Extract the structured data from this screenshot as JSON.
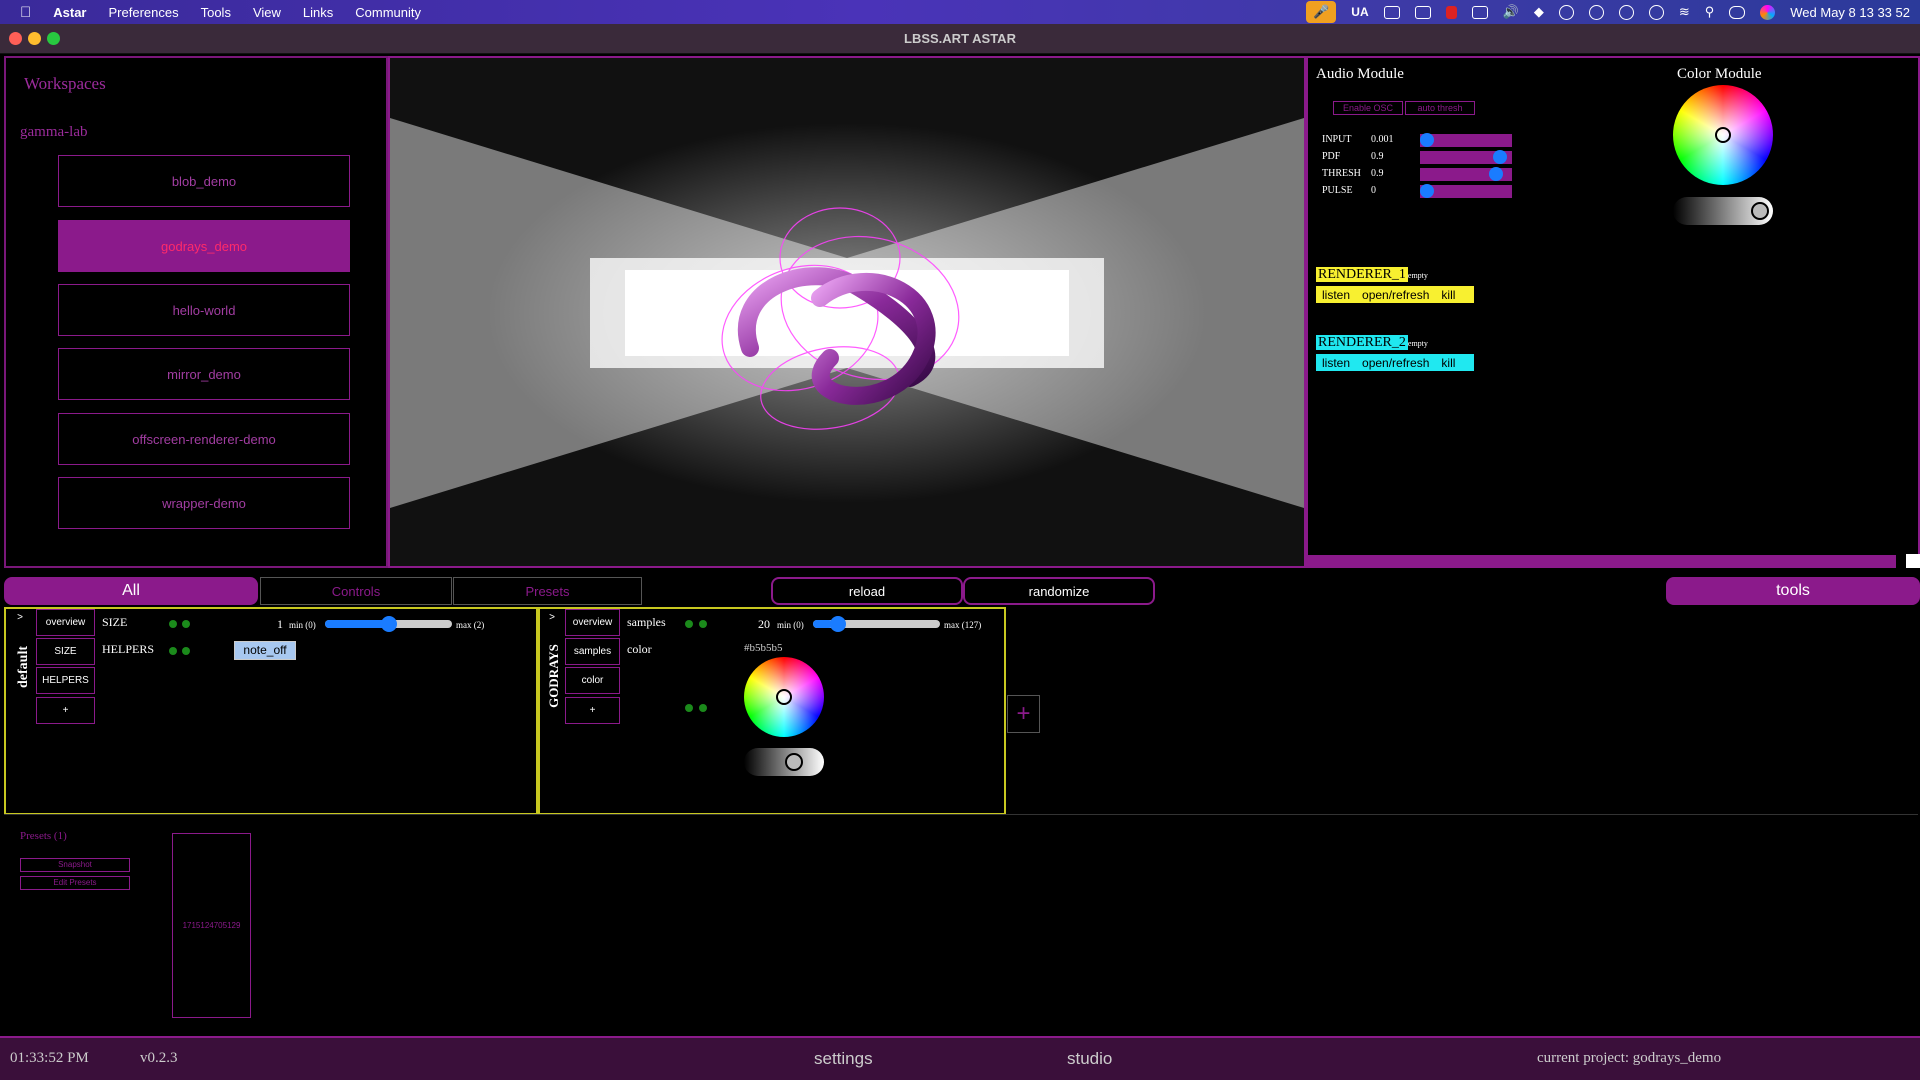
{
  "menubar": {
    "app": "Astar",
    "items": [
      "Preferences",
      "Tools",
      "View",
      "Links",
      "Community"
    ],
    "lang": "UA",
    "clock": "Wed May 8  13 33 52"
  },
  "window": {
    "title": "LBSS.ART ASTAR"
  },
  "workspaces": {
    "title": "Workspaces",
    "group": "gamma-lab",
    "items": [
      {
        "label": "blob_demo"
      },
      {
        "label": "godrays_demo"
      },
      {
        "label": "hello-world"
      },
      {
        "label": "mirror_demo"
      },
      {
        "label": "offscreen-renderer-demo"
      },
      {
        "label": "wrapper-demo"
      }
    ]
  },
  "audio": {
    "title": "Audio Module",
    "enable_osc": "Enable OSC",
    "auto_thresh": "auto thresh",
    "rows": [
      {
        "label": "INPUT",
        "value": "0.001",
        "level": 0.001
      },
      {
        "label": "PDF",
        "value": "0.9",
        "level": 0.9
      },
      {
        "label": "THRESH",
        "value": "0.9",
        "level": 0.9
      },
      {
        "label": "PULSE",
        "value": "0",
        "level": 0
      }
    ]
  },
  "color_module": {
    "title": "Color Module"
  },
  "renderers": [
    {
      "name": "RENDERER_1",
      "status": "empty",
      "listen": "listen",
      "open": "open/refresh",
      "kill": "kill",
      "color": "#f8f030"
    },
    {
      "name": "RENDERER_2",
      "status": "empty",
      "listen": "listen",
      "open": "open/refresh",
      "kill": "kill",
      "color": "#20e8f0"
    }
  ],
  "toolbar": {
    "all": "All",
    "controls": "Controls",
    "presets": "Presets",
    "reload": "reload",
    "randomize": "randomize",
    "tools": "tools"
  },
  "default_box": {
    "title": "default",
    "toggle": ">",
    "side": [
      "overview",
      "SIZE",
      "HELPERS",
      "+"
    ],
    "size": {
      "label": "SIZE",
      "value": "1",
      "min": "min (0)",
      "max": "max (2)",
      "level": 0.5
    },
    "helpers": {
      "label": "HELPERS",
      "button": "note_off"
    }
  },
  "godrays_box": {
    "title": "GODRAYS",
    "toggle": ">",
    "side": [
      "overview",
      "samples",
      "color",
      "+"
    ],
    "samples": {
      "label": "samples",
      "value": "20",
      "min": "min (0)",
      "max": "max (127)",
      "level": 0.157
    },
    "color": {
      "label": "color",
      "hex": "#b5b5b5"
    }
  },
  "add_box": "+",
  "presets": {
    "title": "Presets (1)",
    "snapshot": "Snapshot",
    "edit": "Edit Presets",
    "item": "1715124705129"
  },
  "status": {
    "time": "01:33:52 PM",
    "version": "v0.2.3",
    "settings": "settings",
    "studio": "studio",
    "project": "current project: godrays_demo"
  }
}
